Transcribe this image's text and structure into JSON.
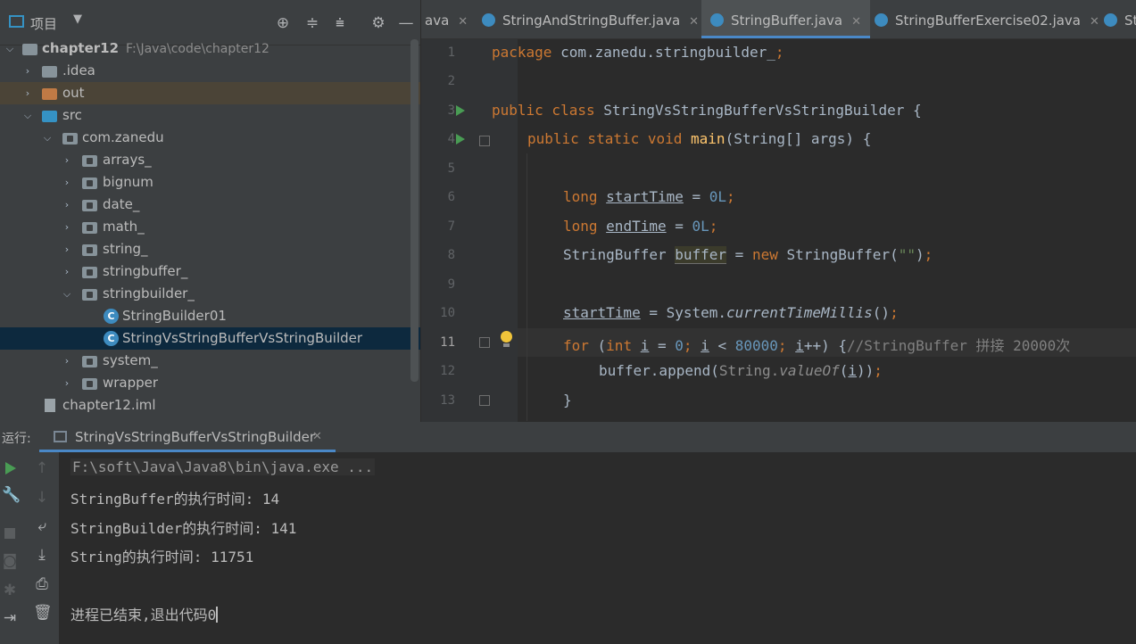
{
  "project": {
    "header_label": "项目",
    "root": {
      "name": "chapter12",
      "path": "F:\\Java\\code\\chapter12"
    },
    "items": [
      {
        "label": ".idea"
      },
      {
        "label": "out"
      },
      {
        "label": "src"
      },
      {
        "label": "com.zanedu"
      },
      {
        "label": "arrays_"
      },
      {
        "label": "bignum"
      },
      {
        "label": "date_"
      },
      {
        "label": "math_"
      },
      {
        "label": "string_"
      },
      {
        "label": "stringbuffer_"
      },
      {
        "label": "stringbuilder_"
      },
      {
        "label": "StringBuilder01"
      },
      {
        "label": "StringVsStringBufferVsStringBuilder"
      },
      {
        "label": "system_"
      },
      {
        "label": "wrapper"
      },
      {
        "label": "chapter12.iml"
      }
    ]
  },
  "editor": {
    "tabs": [
      {
        "label": "ava"
      },
      {
        "label": "StringAndStringBuffer.java"
      },
      {
        "label": "StringBuffer.java"
      },
      {
        "label": "StringBufferExercise02.java"
      },
      {
        "label": "St"
      }
    ],
    "line_numbers": [
      "1",
      "2",
      "3",
      "4",
      "5",
      "6",
      "7",
      "8",
      "9",
      "10",
      "11",
      "12",
      "13"
    ],
    "code": {
      "l1_kw": "package",
      "l1_rest": " com.zanedu.stringbuilder_",
      "l1_semi": ";",
      "l3_kw": "public class",
      "l3_rest": " StringVsStringBufferVsStringBuilder {",
      "l4_kw": "public static void",
      "l4_fn": "main",
      "l4_rest": "(String[] args) {",
      "l6_kw": "long",
      "l6_var": "startTime",
      "l6_eq": " = ",
      "l6_num": "0L",
      "l6_semi": ";",
      "l7_kw": "long",
      "l7_var": "endTime",
      "l7_eq": " = ",
      "l7_num": "0L",
      "l7_semi": ";",
      "l8_type": "StringBuffer ",
      "l8_var": "buffer",
      "l8_eq": " = ",
      "l8_new": "new",
      "l8_rest": " StringBuffer(",
      "l8_str": "\"\"",
      "l8_close": ")",
      "l8_semi": ";",
      "l10_var": "startTime",
      "l10_eq": " = System.",
      "l10_call": "currentTimeMillis",
      "l10_paren": "()",
      "l10_semi": ";",
      "l11_for": "for",
      "l11_a": " (",
      "l11_int": "int",
      "l11_i": "i",
      "l11_b": " = ",
      "l11_zero": "0",
      "l11_s1": ";",
      "l11_i2": "i",
      "l11_c": " < ",
      "l11_n": "80000",
      "l11_s2": ";",
      "l11_i3": "i",
      "l11_d": "++) {",
      "l11_cmt": "//StringBuffer 拼接 20000次",
      "l12_a": "buffer.append(",
      "l12_str": "String",
      "l12_dot": ".",
      "l12_val": "valueOf",
      "l12_p": "(",
      "l12_i": "i",
      "l12_e": "))",
      "l12_semi": ";",
      "l13": "}"
    }
  },
  "run": {
    "label": "运行:",
    "tab_label": "StringVsStringBufferVsStringBuilder",
    "console_lines": [
      "F:\\soft\\Java\\Java8\\bin\\java.exe ...",
      "StringBuffer的执行时间: 14",
      "StringBuilder的执行时间: 141",
      "String的执行时间: 11751",
      "进程已结束,退出代码0"
    ]
  }
}
